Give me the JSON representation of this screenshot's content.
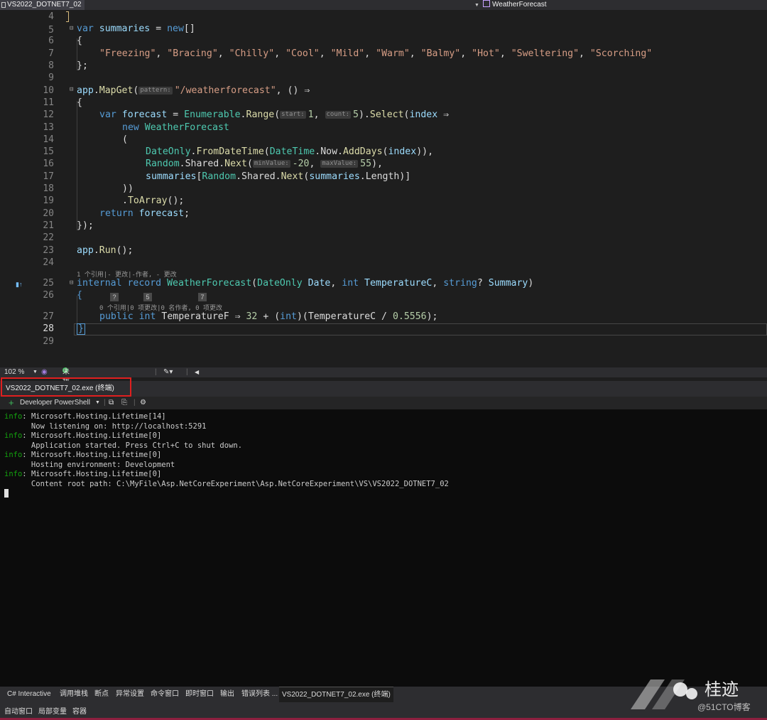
{
  "navbar": {
    "project": "VS2022_DOTNET7_02",
    "member": "WeatherForecast"
  },
  "editor": {
    "line_numbers": [
      "4",
      "5",
      "6",
      "7",
      "8",
      "9",
      "10",
      "11",
      "12",
      "13",
      "14",
      "15",
      "16",
      "17",
      "18",
      "19",
      "20",
      "21",
      "22",
      "23",
      "24",
      "25",
      "26",
      "27",
      "28",
      "29"
    ],
    "codelens_25": "1 个引用|- 更改|-作者, - 更改",
    "codelens_27": "0 个引用|0 项更改|0 名作者, 0 项更改",
    "badges": [
      "?",
      "5",
      "7"
    ],
    "lines": {
      "l5": {
        "kw": "var",
        "name": "summaries",
        "eq": " = ",
        "new": "new",
        "rest": "[]"
      },
      "l6": "{",
      "l7": [
        "\"Freezing\"",
        "\"Bracing\"",
        "\"Chilly\"",
        "\"Cool\"",
        "\"Mild\"",
        "\"Warm\"",
        "\"Balmy\"",
        "\"Hot\"",
        "\"Sweltering\"",
        "\"Scorching\""
      ],
      "l8": "};",
      "l10": {
        "a": "app",
        "b": ".",
        "c": "MapGet",
        "d": "(",
        "hint": "pattern:",
        "e": "\"/weatherforecast\"",
        "f": ", () ⇒"
      },
      "l11": "{",
      "l12": {
        "kw": "var",
        "name": "forecast",
        "eq": " = ",
        "ty": "Enumerable",
        "dot": ".",
        "m": "Range",
        "p": "(",
        "h1": "start:",
        "n1": "1",
        "c": ", ",
        "h2": "count:",
        "n2": "5",
        "p2": ").",
        "m2": "Select",
        "p3": "(",
        "v": "index",
        "arrow": " ⇒"
      },
      "l13": {
        "kw": "new",
        "ty": "WeatherForecast"
      },
      "l14": "(",
      "l15": {
        "ty": "DateOnly",
        "d1": ".",
        "m": "FromDateTime",
        "p": "(",
        "ty2": "DateTime",
        "d2": ".Now.",
        "m2": "AddDays",
        "p2": "(",
        "v": "index",
        "e": ")),"
      },
      "l16": {
        "ty": "Random",
        "d1": ".Shared.",
        "m": "Next",
        "p": "(",
        "h1": "minValue:",
        "n1": "-20",
        "c": ", ",
        "h2": "maxValue:",
        "n2": "55",
        "e": "),"
      },
      "l17": {
        "v": "summaries",
        "b": "[",
        "ty": "Random",
        "d1": ".Shared.",
        "m": "Next",
        "p": "(",
        "v2": "summaries",
        "d2": ".Length)]"
      },
      "l18": "))",
      "l19": {
        "d": ".",
        "m": "ToArray",
        "e": "();"
      },
      "l20": {
        "kw": "return",
        "v": "forecast",
        "e": ";"
      },
      "l21": "});",
      "l23": {
        "a": "app",
        "d": ".",
        "m": "Run",
        "e": "();"
      },
      "l25": {
        "kw1": "internal",
        "kw2": "record",
        "ty": "WeatherForecast",
        "p": "(",
        "ty2": "DateOnly",
        "n1": "Date",
        "c1": ", ",
        "kw3": "int",
        "n2": "TemperatureC",
        "c2": ", ",
        "kw4": "string",
        "q": "?",
        "n3": "Summary",
        "e": ")"
      },
      "l26": "{",
      "l27": {
        "kw1": "public",
        "kw2": "int",
        "n": "TemperatureF",
        "a": " ⇒ ",
        "num1": "32",
        "b": " + (",
        "kw3": "int",
        "c": ")(TemperatureC / ",
        "num2": "0.5556",
        "e": ");"
      },
      "l28": "}"
    }
  },
  "editor_status": {
    "zoom": "102 %",
    "issues": "未找到相关问题"
  },
  "terminal": {
    "tab_title": "VS2022_DOTNET7_02.exe (终端)",
    "shell_label": "Developer PowerShell",
    "lines": [
      {
        "tag": "info",
        "text": ": Microsoft.Hosting.Lifetime[14]"
      },
      {
        "tag": "",
        "text": "      Now listening on: http://localhost:5291"
      },
      {
        "tag": "info",
        "text": ": Microsoft.Hosting.Lifetime[0]"
      },
      {
        "tag": "",
        "text": "      Application started. Press Ctrl+C to shut down."
      },
      {
        "tag": "info",
        "text": ": Microsoft.Hosting.Lifetime[0]"
      },
      {
        "tag": "",
        "text": "      Hosting environment: Development"
      },
      {
        "tag": "info",
        "text": ": Microsoft.Hosting.Lifetime[0]"
      },
      {
        "tag": "",
        "text": "      Content root path: C:\\MyFile\\Asp.NetCoreExperiment\\Asp.NetCoreExperiment\\VS\\VS2022_DOTNET7_02"
      }
    ]
  },
  "bottom_tabs": [
    "C# Interactive",
    "调用堆栈",
    "断点",
    "异常设置",
    "命令窗口",
    "即时窗口",
    "输出",
    "错误列表 ...",
    "VS2022_DOTNET7_02.exe (终端)"
  ],
  "bottom_tabs2": [
    "自动窗口",
    "局部变量",
    "容器"
  ],
  "watermark": {
    "name": "桂迹",
    "site": "@51CTO博客"
  }
}
